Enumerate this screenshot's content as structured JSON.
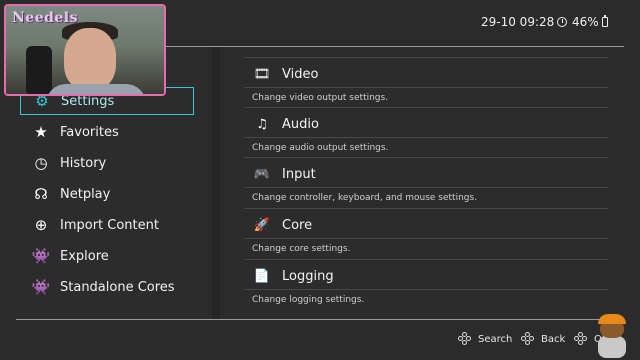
{
  "status": {
    "datetime": "29-10 09:28",
    "battery": "46%"
  },
  "overlay": {
    "name_tag": "Needels"
  },
  "sidebar": {
    "items": [
      {
        "label": "Settings",
        "icon": "gear-icon",
        "active": true
      },
      {
        "label": "Favorites",
        "icon": "star-icon"
      },
      {
        "label": "History",
        "icon": "history-icon"
      },
      {
        "label": "Netplay",
        "icon": "headset-icon"
      },
      {
        "label": "Import Content",
        "icon": "plus-icon"
      },
      {
        "label": "Explore",
        "icon": "invader-icon"
      },
      {
        "label": "Standalone Cores",
        "icon": "invader-icon"
      }
    ]
  },
  "settings": {
    "entries": [
      {
        "label": "Video",
        "desc": "Change video output settings.",
        "icon": "film-icon"
      },
      {
        "label": "Audio",
        "desc": "Change audio output settings.",
        "icon": "music-note-icon"
      },
      {
        "label": "Input",
        "desc": "Change controller, keyboard, and mouse settings.",
        "icon": "gamepad-icon"
      },
      {
        "label": "Core",
        "desc": "Change core settings.",
        "icon": "rocket-icon"
      },
      {
        "label": "Logging",
        "desc": "Change logging settings.",
        "icon": "file-icon"
      }
    ]
  },
  "footer": {
    "search": "Search",
    "back": "Back",
    "ok": "OK"
  }
}
